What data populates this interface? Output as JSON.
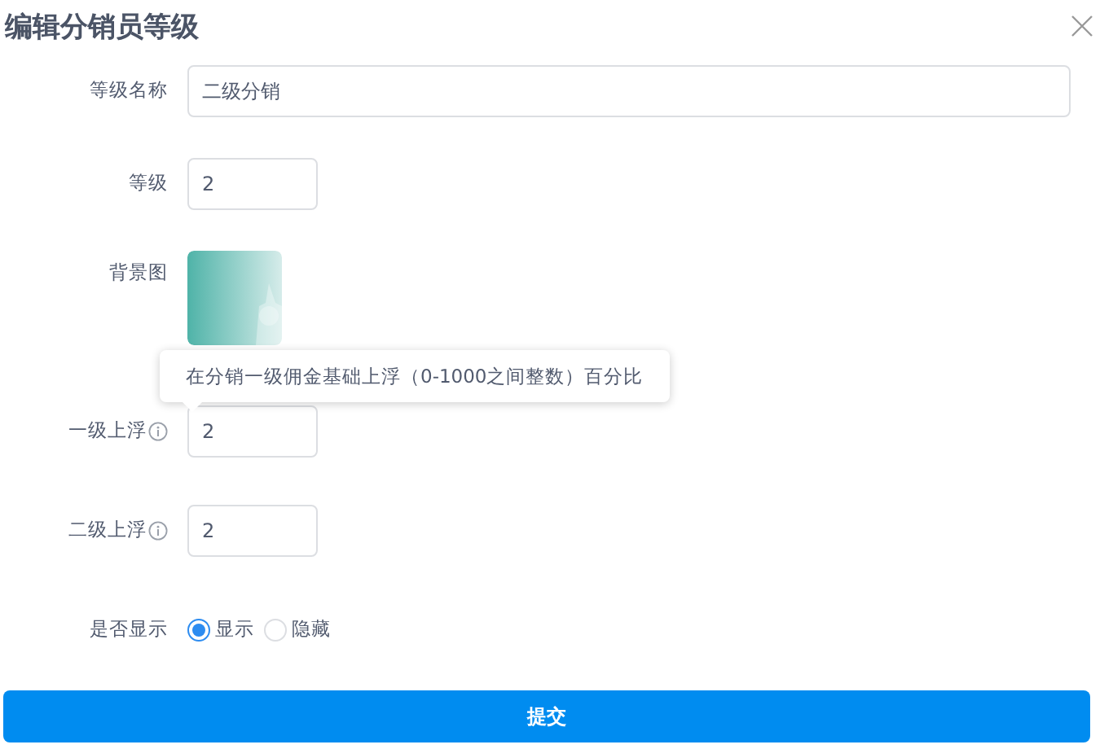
{
  "dialog": {
    "title": "编辑分销员等级"
  },
  "fields": [
    {
      "kind": "text",
      "label": "等级名称",
      "value": "二级分销",
      "info": false
    },
    {
      "kind": "number",
      "label": "等级",
      "value": "2",
      "info": false
    },
    {
      "label": "背景图"
    },
    {
      "kind": "number",
      "label": "一级上浮",
      "value": "2",
      "info": true
    },
    {
      "kind": "number",
      "label": "二级上浮",
      "value": "2",
      "info": true
    },
    {
      "kind": "radio",
      "label": "是否显示",
      "options": [
        {
          "label": "显示",
          "selected": true
        },
        {
          "label": "隐藏",
          "selected": false
        }
      ]
    }
  ],
  "tooltip": {
    "text": "在分销一级佣金基础上浮（0-1000之间整数）百分比"
  },
  "submit": "提交"
}
